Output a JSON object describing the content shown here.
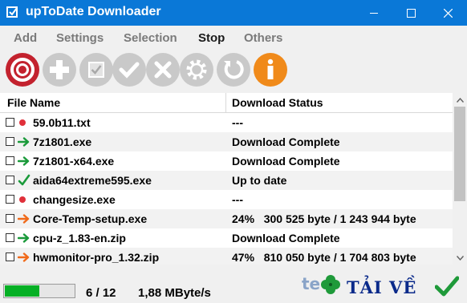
{
  "window": {
    "title": "upToDate Downloader",
    "controls": [
      "minimize-icon",
      "maximize-icon",
      "close-icon"
    ]
  },
  "menu": [
    {
      "label": "Add",
      "active": false
    },
    {
      "label": "Settings",
      "active": false
    },
    {
      "label": "Selection",
      "active": false
    },
    {
      "label": "Stop",
      "active": true
    },
    {
      "label": "Others",
      "active": false
    }
  ],
  "toolbar": [
    {
      "icon": "stop-icon",
      "enabled": true,
      "color": "#c3222e"
    },
    {
      "icon": "add-icon",
      "enabled": false
    },
    {
      "icon": "select-all-icon",
      "enabled": false
    },
    {
      "icon": "check-icon",
      "enabled": false
    },
    {
      "icon": "cancel-icon",
      "enabled": false
    },
    {
      "icon": "settings-gear-icon",
      "enabled": false
    },
    {
      "icon": "refresh-icon",
      "enabled": false
    },
    {
      "icon": "info-icon",
      "enabled": true,
      "color": "#f08a1a"
    }
  ],
  "table": {
    "columns": [
      "File Name",
      "Download Status"
    ],
    "rows": [
      {
        "name": "59.0b11.txt",
        "status_icon": "red-dot-icon",
        "status": "---"
      },
      {
        "name": "7z1801.exe",
        "status_icon": "green-arrow-icon",
        "status": "Download Complete"
      },
      {
        "name": "7z1801-x64.exe",
        "status_icon": "green-arrow-icon",
        "status": "Download Complete"
      },
      {
        "name": "aida64extreme595.exe",
        "status_icon": "green-check-icon",
        "status": "Up to date"
      },
      {
        "name": "changesize.exe",
        "status_icon": "red-dot-icon",
        "status": "---"
      },
      {
        "name": "Core-Temp-setup.exe",
        "status_icon": "orange-arrow-icon",
        "status": "24%   300 525 byte / 1 243 944 byte"
      },
      {
        "name": "cpu-z_1.83-en.zip",
        "status_icon": "green-arrow-icon",
        "status": "Download Complete"
      },
      {
        "name": "hwmonitor-pro_1.32.zip",
        "status_icon": "orange-arrow-icon",
        "status": "47%   810 050 byte / 1 704 803 byte"
      }
    ]
  },
  "status": {
    "progress": 0.5,
    "count": "6 / 12",
    "speed": "1,88 MByte/s"
  },
  "watermark": {
    "prefix": "te",
    "text": "TẢI VỀ"
  },
  "colors": {
    "titlebar": "#0a78d7",
    "progress": "#06b025",
    "green": "#1a9a3a",
    "orange": "#f06a1a",
    "red": "#e0303a"
  }
}
